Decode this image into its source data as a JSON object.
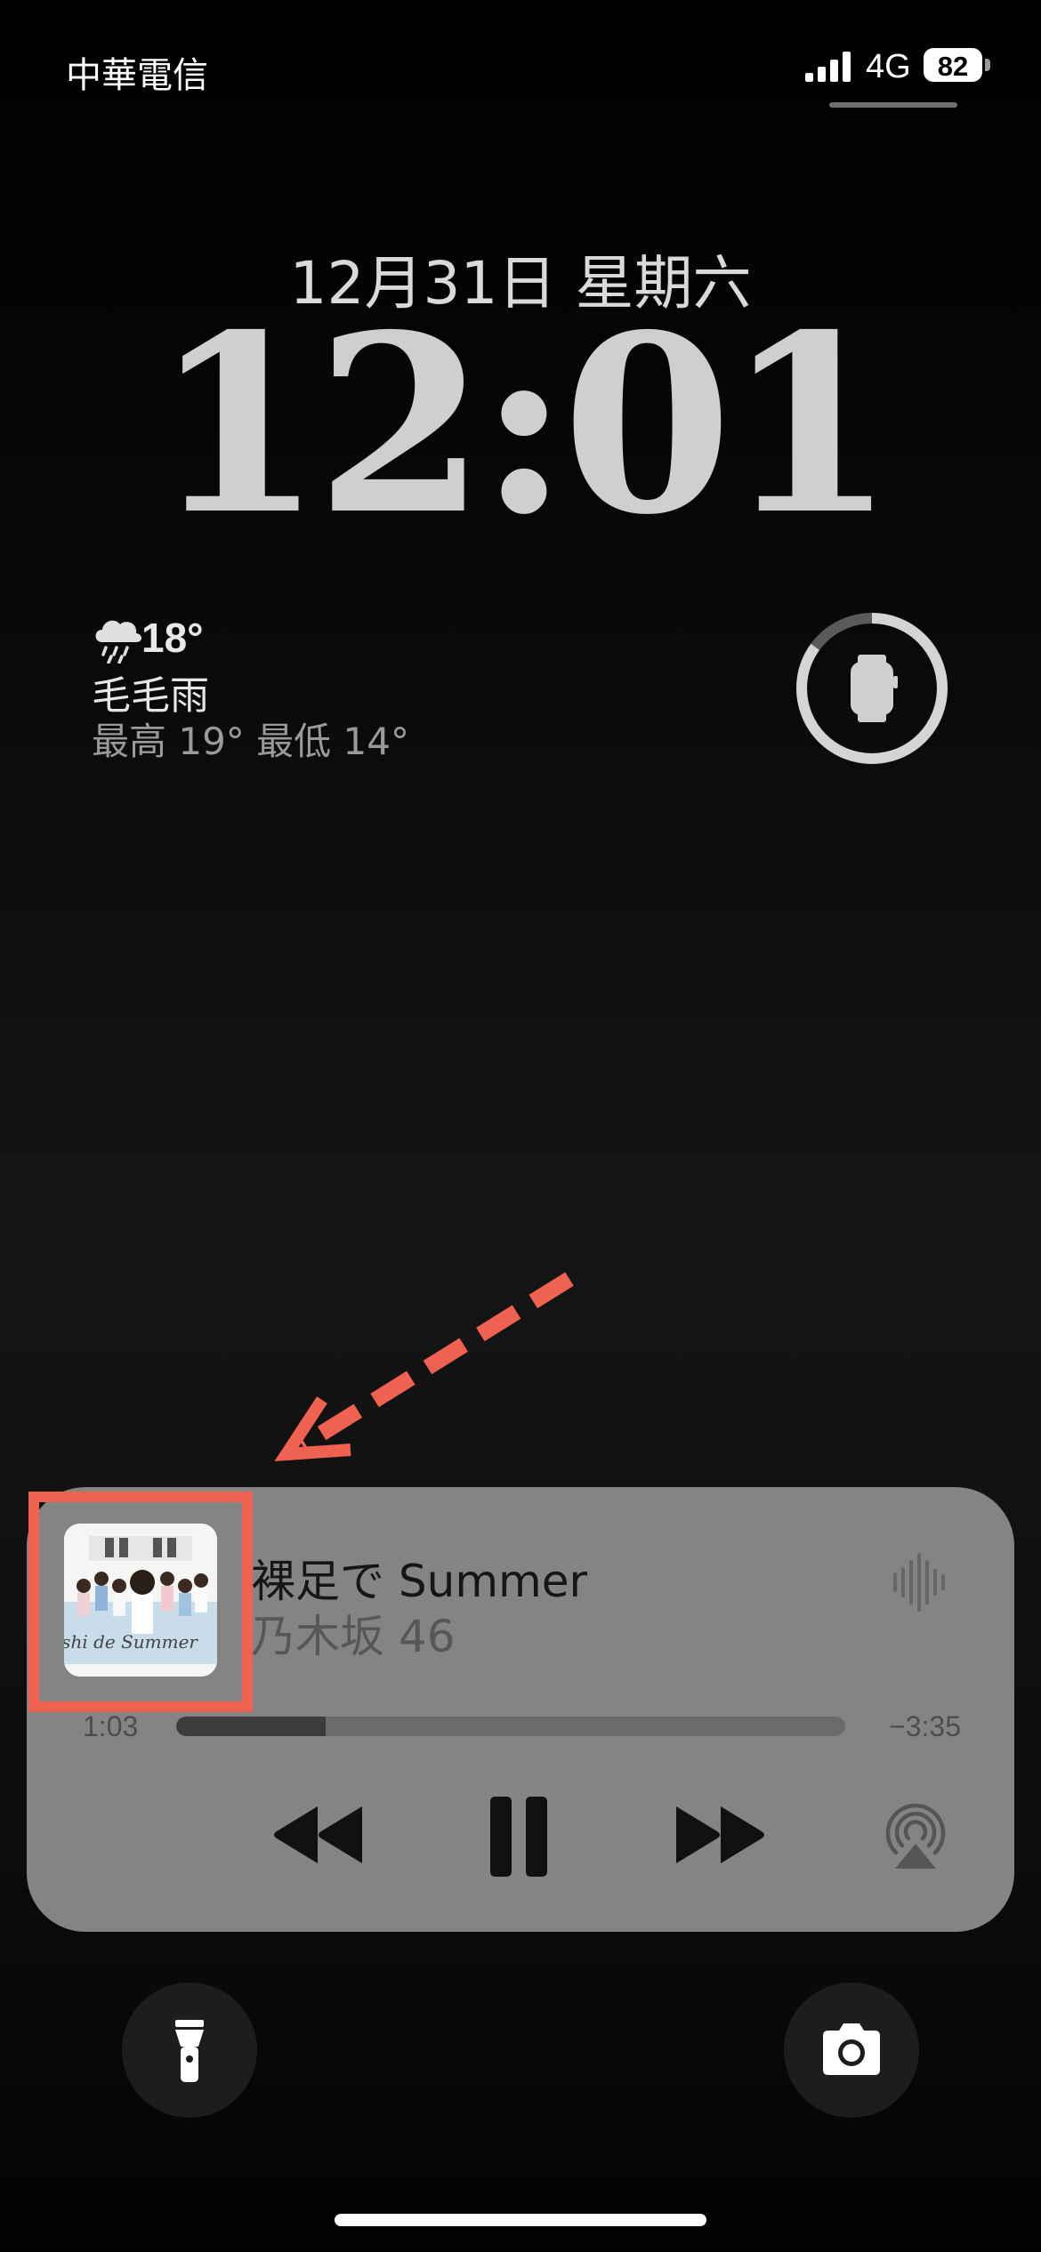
{
  "status_bar": {
    "carrier": "中華電信",
    "network": "4G",
    "battery_level": "82"
  },
  "lock_screen": {
    "date": "12月31日 星期六",
    "time": "12:01"
  },
  "weather": {
    "icon": "cloud-drizzle-icon",
    "temperature": "18°",
    "condition": "毛毛雨",
    "high_low": "最高 19° 最低 14°"
  },
  "watch_widget": {
    "icon": "apple-watch-icon",
    "battery_fraction": 0.85
  },
  "now_playing": {
    "title": "裸足で Summer",
    "artist": "乃木坂 46",
    "album_art_text": "Hadashi de Summer",
    "elapsed": "1:03",
    "remaining": "−3:35",
    "progress_fraction": 0.224,
    "controls": {
      "previous": "rewind-icon",
      "play_pause": "pause-icon",
      "next": "fast-forward-icon",
      "airplay": "airplay-icon"
    }
  },
  "quick_actions": {
    "flashlight": "flashlight-icon",
    "camera": "camera-icon"
  },
  "annotation": {
    "highlight_color": "#ef6150"
  }
}
